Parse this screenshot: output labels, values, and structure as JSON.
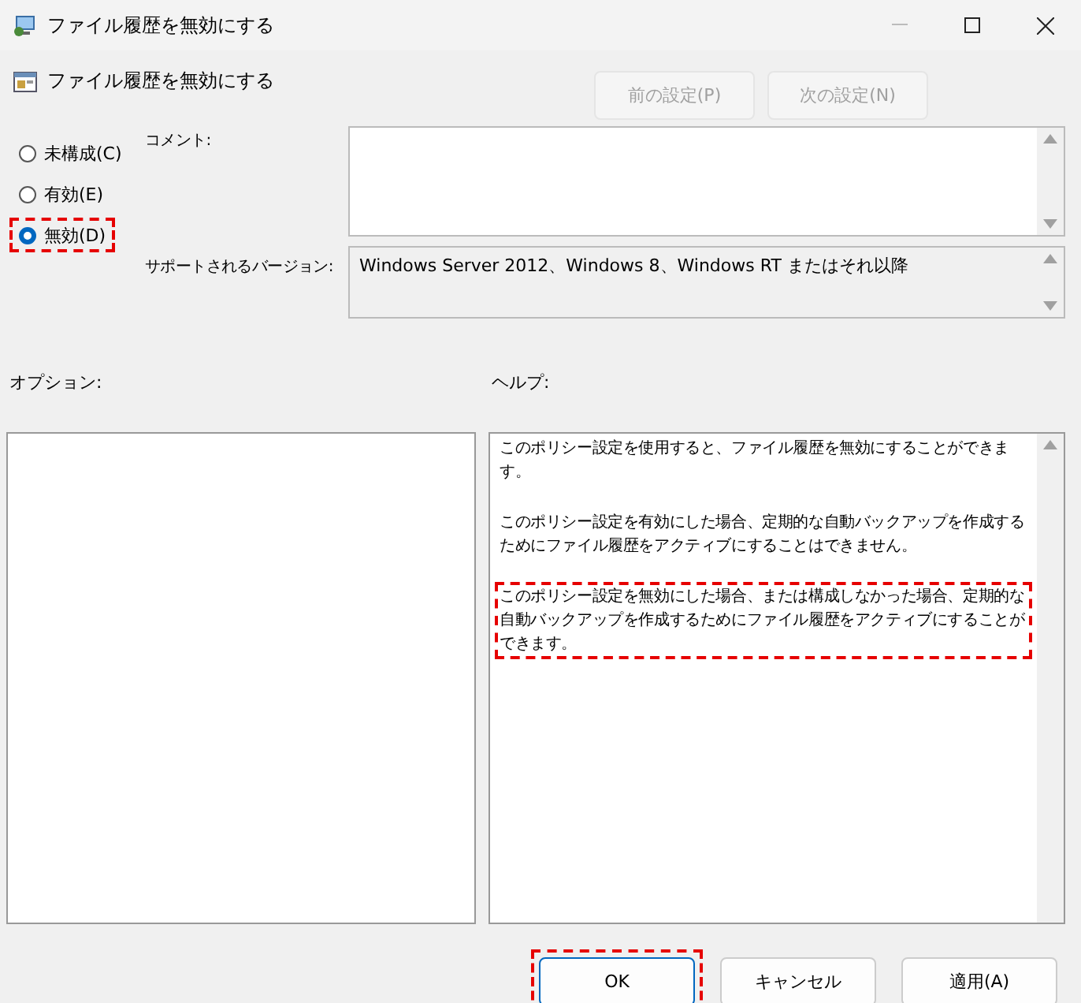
{
  "window": {
    "title": "ファイル履歴を無効にする"
  },
  "policy_title": "ファイル履歴を無効にする",
  "nav_buttons": [
    {
      "label": "前の設定(P)",
      "disabled": true
    },
    {
      "label": "次の設定(N)",
      "disabled": true
    }
  ],
  "radios": [
    {
      "label": "未構成(C)",
      "selected": false,
      "highlighted": false
    },
    {
      "label": "有効(E)",
      "selected": false,
      "highlighted": false
    },
    {
      "label": "無効(D)",
      "selected": true,
      "highlighted": true
    }
  ],
  "comment": {
    "label": "コメント:"
  },
  "supported": {
    "label": "サポートされるバージョン:",
    "value": "Windows Server 2012、Windows 8、Windows RT またはそれ以降"
  },
  "options": {
    "label": "オプション:"
  },
  "help": {
    "label": "ヘルプ:",
    "paragraphs": [
      {
        "text": "このポリシー設定を使用すると、ファイル履歴を無効にすることができます。",
        "highlighted": false
      },
      {
        "text": "このポリシー設定を有効にした場合、定期的な自動バックアップを作成するためにファイル履歴をアクティブにすることはできません。",
        "highlighted": false
      },
      {
        "text": "このポリシー設定を無効にした場合、または構成しなかった場合、定期的な自動バックアップを作成するためにファイル履歴をアクティブにすることができます。",
        "highlighted": true
      }
    ]
  },
  "buttons": [
    {
      "label": "OK",
      "kind": "default",
      "highlighted": true
    },
    {
      "label": "キャンセル",
      "kind": "normal",
      "highlighted": false
    },
    {
      "label": "適用(A)",
      "kind": "normal",
      "highlighted": false
    }
  ]
}
